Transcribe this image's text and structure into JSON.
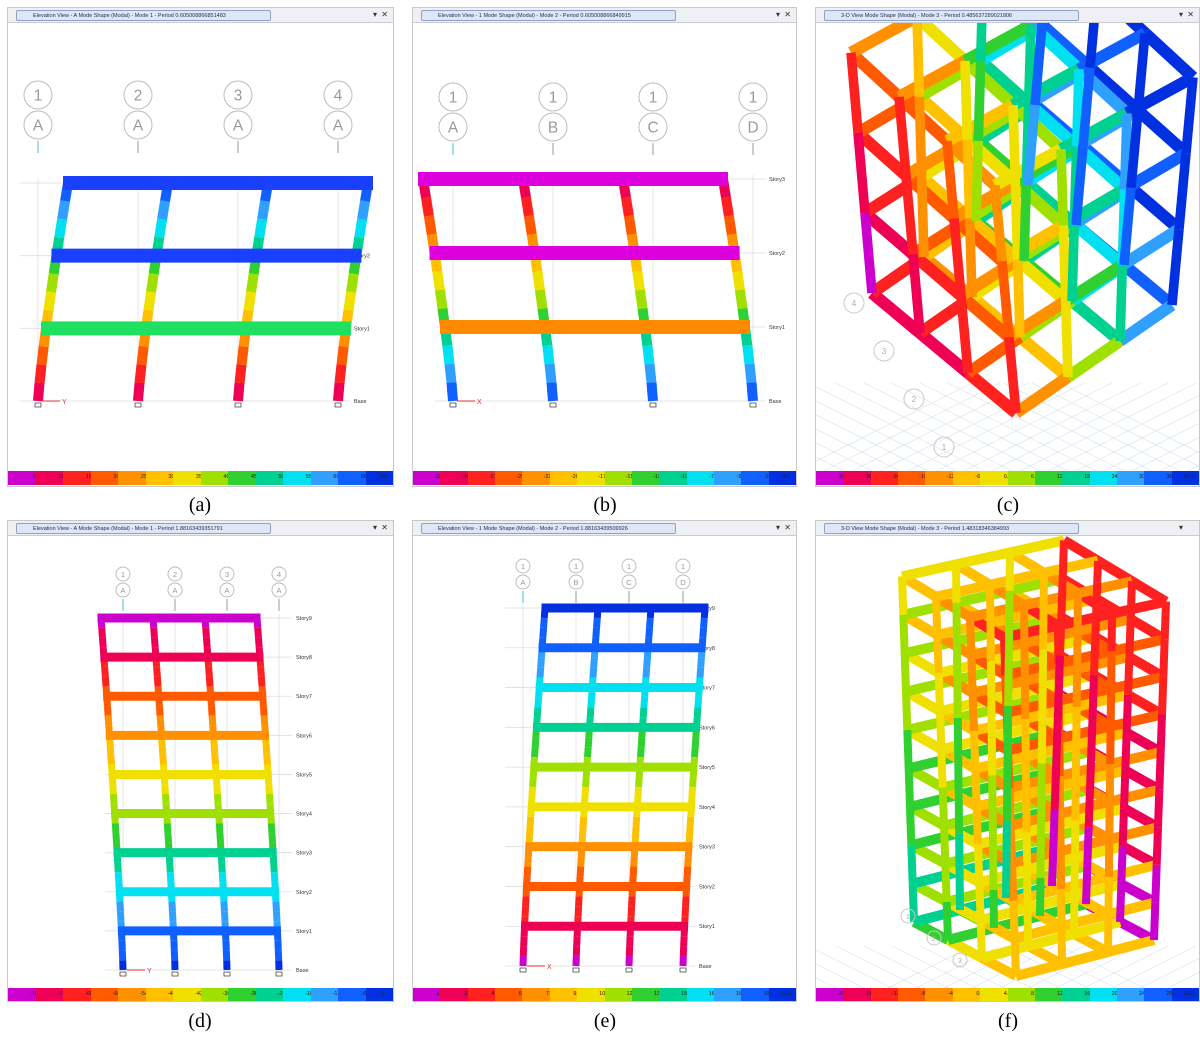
{
  "panels": [
    {
      "id": "a",
      "title": "Elevation View - A  Mode Shape (Modal) - Mode 1 - Period 0.605008866851483",
      "caption": "(a)",
      "legend": [
        "50",
        "100",
        "150",
        "200",
        "250",
        "300",
        "350",
        "400",
        "450",
        "500",
        "550",
        "600",
        "650",
        "700"
      ],
      "grid_top": [
        "1",
        "2",
        "3",
        "4"
      ],
      "grid_bottom": [
        "A",
        "A",
        "A",
        "A"
      ],
      "levels": [
        "Story3",
        "Story2",
        "Story1",
        "Base"
      ],
      "axis_label": "Y"
    },
    {
      "id": "b",
      "title": "Elevation View - 1  Mode Shape (Modal) - Mode 2 - Period 0.605008866849915",
      "caption": "(b)",
      "legend": [
        "-32.5",
        "-30.0",
        "-27.5",
        "-25.0",
        "-22.5",
        "-20.0",
        "-17.5",
        "-15.0",
        "-12.5",
        "-10.0",
        "-7.5",
        "-5.0",
        "-2.5",
        "0.0"
      ],
      "grid_top": [
        "1",
        "1",
        "1",
        "1"
      ],
      "grid_bottom": [
        "A",
        "B",
        "C",
        "D"
      ],
      "levels": [
        "Story3",
        "Story2",
        "Story1",
        "Base"
      ],
      "axis_label": "X"
    },
    {
      "id": "c",
      "title": "3-D View  Mode Shape (Modal) - Mode 3 - Period 0.485637289021806",
      "caption": "(c)",
      "legend": [
        "-36.0",
        "-30.0",
        "-24.0",
        "-18.0",
        "-12.0",
        "-6.0",
        "0.0",
        "6.0",
        "12.0",
        "18.0",
        "24.0",
        "30.0",
        "36.0",
        "42.0"
      ],
      "floor_labels": [
        "4",
        "3",
        "2",
        "1"
      ]
    },
    {
      "id": "d",
      "title": "Elevation View - A  Mode Shape (Modal) - Mode 1 - Period 1.88163439351791",
      "caption": "(d)",
      "legend": [
        "-780",
        "-720",
        "-660",
        "-600",
        "-540",
        "-480",
        "-420",
        "-360",
        "-300",
        "-240",
        "-180",
        "-120",
        "-60",
        "0"
      ],
      "grid_top": [
        "1",
        "2",
        "3",
        "4"
      ],
      "grid_bottom": [
        "A",
        "A",
        "A",
        "A"
      ],
      "levels": [
        "Story9",
        "Story8",
        "Story7",
        "Story6",
        "Story5",
        "Story4",
        "Story3",
        "Story2",
        "Story1",
        "Base"
      ],
      "axis_label": "Y"
    },
    {
      "id": "e",
      "title": "Elevation View - 1  Mode Shape (Modal) - Mode 2 - Period 1.88163439509926",
      "caption": "(e)",
      "legend": [
        "1.5",
        "3.0",
        "4.5",
        "6.0",
        "7.5",
        "9.0",
        "10.5",
        "12.0",
        "13.5",
        "15.0",
        "16.5",
        "18.0",
        "19.5",
        "21.0"
      ],
      "grid_top": [
        "1",
        "1",
        "1",
        "1"
      ],
      "grid_bottom": [
        "A",
        "B",
        "C",
        "D"
      ],
      "levels": [
        "Story9",
        "Story8",
        "Story7",
        "Story6",
        "Story5",
        "Story4",
        "Story3",
        "Story2",
        "Story1",
        "Base"
      ],
      "axis_label": "X"
    },
    {
      "id": "f",
      "title": "3-D View  Mode Shape (Modal) - Mode 3 - Period 1.48318346384993",
      "caption": "(f)",
      "legend": [
        "-28.0",
        "-16.0",
        "-12.0",
        "-8.0",
        "-4.0",
        "0.0",
        "4.0",
        "8.0",
        "12.0",
        "16.0",
        "20.0",
        "24.0",
        "28.0",
        "32.0"
      ],
      "floor_labels": [
        "1",
        "2",
        "3"
      ]
    }
  ],
  "controls": {
    "menu": "▾",
    "close": "✕"
  },
  "colors": {
    "legend": [
      "#cc00cc",
      "#ee0055",
      "#ff2020",
      "#ff5a00",
      "#ff9000",
      "#ffc000",
      "#f0e000",
      "#a0e000",
      "#30d030",
      "#00d090",
      "#00e0f0",
      "#30a0ff",
      "#1060ff",
      "#0030e0"
    ]
  }
}
